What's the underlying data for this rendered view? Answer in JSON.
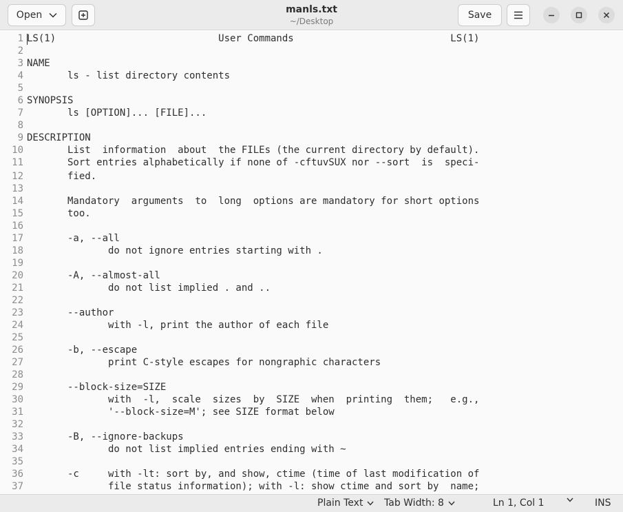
{
  "header": {
    "open_label": "Open",
    "save_label": "Save",
    "title": "manls.txt",
    "subtitle": "~/Desktop"
  },
  "icons": {
    "open_dropdown": "chevron-down-icon",
    "new_tab": "new-tab-icon",
    "menu": "hamburger-menu-icon",
    "minimize": "minimize-icon",
    "maximize": "maximize-icon",
    "close": "close-icon"
  },
  "editor": {
    "lines": [
      {
        "n": "1",
        "t": "LS(1)                            User Commands                           LS(1)"
      },
      {
        "n": "2",
        "t": ""
      },
      {
        "n": "3",
        "t": "NAME"
      },
      {
        "n": "4",
        "t": "       ls - list directory contents"
      },
      {
        "n": "5",
        "t": ""
      },
      {
        "n": "6",
        "t": "SYNOPSIS"
      },
      {
        "n": "7",
        "t": "       ls [OPTION]... [FILE]..."
      },
      {
        "n": "8",
        "t": ""
      },
      {
        "n": "9",
        "t": "DESCRIPTION"
      },
      {
        "n": "10",
        "t": "       List  information  about  the FILEs (the current directory by default)."
      },
      {
        "n": "11",
        "t": "       Sort entries alphabetically if none of -cftuvSUX nor --sort  is  speci-"
      },
      {
        "n": "12",
        "t": "       fied."
      },
      {
        "n": "13",
        "t": ""
      },
      {
        "n": "14",
        "t": "       Mandatory  arguments  to  long  options are mandatory for short options"
      },
      {
        "n": "15",
        "t": "       too."
      },
      {
        "n": "16",
        "t": ""
      },
      {
        "n": "17",
        "t": "       -a, --all"
      },
      {
        "n": "18",
        "t": "              do not ignore entries starting with ."
      },
      {
        "n": "19",
        "t": ""
      },
      {
        "n": "20",
        "t": "       -A, --almost-all"
      },
      {
        "n": "21",
        "t": "              do not list implied . and .."
      },
      {
        "n": "22",
        "t": ""
      },
      {
        "n": "23",
        "t": "       --author"
      },
      {
        "n": "24",
        "t": "              with -l, print the author of each file"
      },
      {
        "n": "25",
        "t": ""
      },
      {
        "n": "26",
        "t": "       -b, --escape"
      },
      {
        "n": "27",
        "t": "              print C-style escapes for nongraphic characters"
      },
      {
        "n": "28",
        "t": ""
      },
      {
        "n": "29",
        "t": "       --block-size=SIZE"
      },
      {
        "n": "30",
        "t": "              with  -l,  scale  sizes  by  SIZE  when  printing  them;   e.g.,"
      },
      {
        "n": "31",
        "t": "              '--block-size=M'; see SIZE format below"
      },
      {
        "n": "32",
        "t": ""
      },
      {
        "n": "33",
        "t": "       -B, --ignore-backups"
      },
      {
        "n": "34",
        "t": "              do not list implied entries ending with ~"
      },
      {
        "n": "35",
        "t": ""
      },
      {
        "n": "36",
        "t": "       -c     with -lt: sort by, and show, ctime (time of last modification of"
      },
      {
        "n": "37",
        "t": "              file status information); with -l: show ctime and sort by  name;"
      }
    ]
  },
  "status": {
    "language": "Plain Text",
    "tab_width": "Tab Width: 8",
    "position": "Ln 1, Col 1",
    "mode": "INS"
  }
}
